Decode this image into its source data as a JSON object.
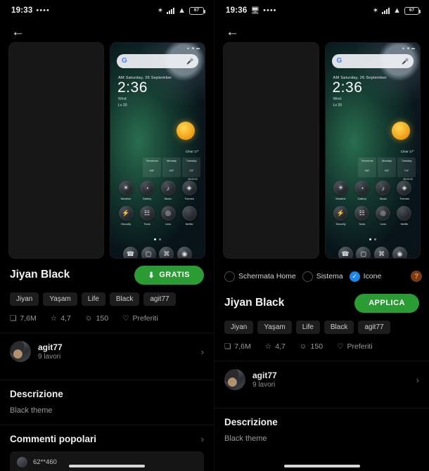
{
  "theme": {
    "accent_green": "#2b9b33",
    "accent_blue": "#1b87ea",
    "help_orange": "#f09a44",
    "background": "#000000",
    "chip_bg": "#1d1d1d"
  },
  "left": {
    "status": {
      "time": "19:33",
      "dots": "••••",
      "bluetooth_icon": "bluetooth-icon",
      "signal_icon": "signal-bars-icon",
      "wifi_icon": "wifi-icon",
      "battery_level": "67"
    },
    "back_icon": "back-arrow-icon",
    "preview": {
      "left_thumb": "blank-preview",
      "home": {
        "search_placeholder": "",
        "google_letter": "G",
        "mic_icon": "microphone-icon",
        "date": "AM Saturday, 26 September",
        "clock": "2:36",
        "wind_label": "Wind:",
        "wind_value": "Lv 20",
        "clear_label": "Clear  17°",
        "forecast": [
          {
            "day": "Tomorrow",
            "temp": "9/8°"
          },
          {
            "day": "Monday",
            "temp": "9/9°"
          },
          {
            "day": "Tuesday",
            "temp": "7/3°"
          }
        ],
        "forecast_mark": "48:00:00",
        "apps_row1": [
          {
            "label": "Weather",
            "icon": "weather-icon",
            "glyph": "☀"
          },
          {
            "label": "Gallery",
            "icon": "gallery-icon",
            "glyph": "◔"
          },
          {
            "label": "Music",
            "icon": "music-icon",
            "glyph": "♪"
          },
          {
            "label": "Themes",
            "icon": "themes-icon",
            "glyph": "◈"
          }
        ],
        "apps_row2": [
          {
            "label": "Security",
            "icon": "security-icon",
            "glyph": "⚡"
          },
          {
            "label": "Tools",
            "icon": "tools-icon",
            "glyph": "☷"
          },
          {
            "label": "Lens",
            "icon": "lens-icon",
            "glyph": "◎"
          },
          {
            "label": "Netflix",
            "icon": "netflix-icon",
            "glyph": ""
          }
        ],
        "dock": [
          {
            "icon": "phone-icon",
            "glyph": "☎"
          },
          {
            "icon": "messages-icon",
            "glyph": "▢"
          },
          {
            "icon": "browser-icon",
            "glyph": "⌘"
          },
          {
            "icon": "camera-icon",
            "glyph": "◉"
          }
        ]
      }
    },
    "title": "Jiyan Black",
    "cta_label": "GRATIS",
    "cta_icon": "download-icon",
    "tags": [
      "Jiyan",
      "Yaşam",
      "Life",
      "Black",
      "agit77"
    ],
    "stats": [
      {
        "icon": "size-icon",
        "glyph": "❑",
        "value": "7,6M"
      },
      {
        "icon": "star-icon",
        "glyph": "☆",
        "value": "4,7"
      },
      {
        "icon": "comment-icon",
        "glyph": "☺",
        "value": "150"
      },
      {
        "icon": "heart-icon",
        "glyph": "♡",
        "value": "Preferiti"
      }
    ],
    "author": {
      "name": "agit77",
      "works": "9 lavori",
      "chevron": "›"
    },
    "description": {
      "title": "Descrizione",
      "body": "Black theme"
    },
    "comments": {
      "title": "Commenti popolari",
      "chevron": "›",
      "peek_name": "62**460"
    }
  },
  "right": {
    "status": {
      "time": "19:36",
      "cast_icon": "cast-icon",
      "dots": "••••",
      "bluetooth_icon": "bluetooth-icon",
      "signal_icon": "signal-bars-icon",
      "wifi_icon": "wifi-icon",
      "battery_level": "67"
    },
    "back_icon": "back-arrow-icon",
    "options": [
      {
        "label": "Schermata Home",
        "checked": false
      },
      {
        "label": "Sistema",
        "checked": false
      },
      {
        "label": "Icone",
        "checked": true
      }
    ],
    "help_icon": "help-icon",
    "help_glyph": "?",
    "title": "Jiyan Black",
    "cta_label": "APPLICA",
    "tags": [
      "Jiyan",
      "Yaşam",
      "Life",
      "Black",
      "agit77"
    ],
    "stats": [
      {
        "icon": "size-icon",
        "glyph": "❑",
        "value": "7,6M"
      },
      {
        "icon": "star-icon",
        "glyph": "☆",
        "value": "4,7"
      },
      {
        "icon": "comment-icon",
        "glyph": "☺",
        "value": "150"
      },
      {
        "icon": "heart-icon",
        "glyph": "♡",
        "value": "Preferiti"
      }
    ],
    "author": {
      "name": "agit77",
      "works": "9 lavori",
      "chevron": "›"
    },
    "description": {
      "title": "Descrizione",
      "body": "Black theme"
    }
  }
}
